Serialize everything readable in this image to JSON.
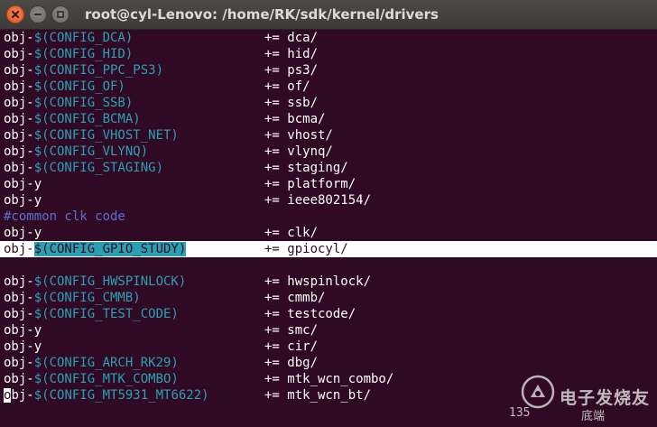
{
  "window": {
    "title": "root@cyl-Lenovo: /home/RK/sdk/kernel/drivers"
  },
  "icons": {
    "close": "close-icon",
    "minimize": "minimize-icon",
    "maximize": "maximize-icon"
  },
  "terminal": {
    "lines": [
      {
        "prefix": "obj-",
        "var": "$(CONFIG_DCA)",
        "op": "+= dca/"
      },
      {
        "prefix": "obj-",
        "var": "$(CONFIG_HID)",
        "op": "+= hid/"
      },
      {
        "prefix": "obj-",
        "var": "$(CONFIG_PPC_PS3)",
        "op": "+= ps3/"
      },
      {
        "prefix": "obj-",
        "var": "$(CONFIG_OF)",
        "op": "+= of/"
      },
      {
        "prefix": "obj-",
        "var": "$(CONFIG_SSB)",
        "op": "+= ssb/"
      },
      {
        "prefix": "obj-",
        "var": "$(CONFIG_BCMA)",
        "op": "+= bcma/"
      },
      {
        "prefix": "obj-",
        "var": "$(CONFIG_VHOST_NET)",
        "op": "+= vhost/"
      },
      {
        "prefix": "obj-",
        "var": "$(CONFIG_VLYNQ)",
        "op": "+= vlynq/"
      },
      {
        "prefix": "obj-",
        "var": "$(CONFIG_STAGING)",
        "op": "+= staging/"
      },
      {
        "prefix": "obj-y",
        "var": "",
        "op": "+= platform/"
      },
      {
        "prefix": "obj-y",
        "var": "",
        "op": "+= ieee802154/"
      },
      {
        "comment": "#common clk code"
      },
      {
        "prefix": "obj-y",
        "var": "",
        "op": "+= clk/"
      },
      {
        "prefix": "obj-",
        "var": "$(CONFIG_GPIO_STUDY)",
        "op": "+= gpiocyl/",
        "highlight": true
      },
      {
        "blank": true
      },
      {
        "prefix": "obj-",
        "var": "$(CONFIG_HWSPINLOCK)",
        "op": "+= hwspinlock/"
      },
      {
        "prefix": "obj-",
        "var": "$(CONFIG_CMMB)",
        "op": "+= cmmb/"
      },
      {
        "prefix": "obj-",
        "var": "$(CONFIG_TEST_CODE)",
        "op": "+= testcode/"
      },
      {
        "prefix": "obj-y",
        "var": "",
        "op": "+= smc/"
      },
      {
        "prefix": "obj-y",
        "var": "",
        "op": "+= cir/"
      },
      {
        "prefix": "obj-",
        "var": "$(CONFIG_ARCH_RK29)",
        "op": "+= dbg/"
      },
      {
        "prefix": "obj-",
        "var": "$(CONFIG_MTK_COMBO)",
        "op": "+= mtk_wcn_combo/"
      },
      {
        "prefix": "obj-",
        "var": "$(CONFIG_MT5931_MT6622)",
        "op": "+= mtk_wcn_bt/",
        "cursor": true
      }
    ]
  },
  "watermark": {
    "brand": "电子发烧友",
    "line_number": "135",
    "sub": "底端"
  },
  "colors": {
    "background": "#300a24",
    "variable": "#2aa1b3",
    "comment": "#5c6fd1",
    "text": "#ffffff",
    "close_button": "#e05a2a"
  }
}
